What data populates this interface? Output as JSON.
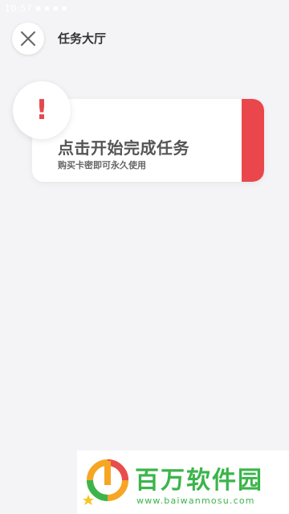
{
  "status_bar": {
    "time": "10:57",
    "icons": [
      "notification-icon",
      "wechat-icon",
      "signal-icon",
      "wifi-icon"
    ]
  },
  "header": {
    "title": "任务大厅",
    "close_icon": "close-icon"
  },
  "task_card": {
    "badge_icon": "alert-icon",
    "badge_symbol": "!",
    "title": "点击开始完成任务",
    "subtitle": "购买卡密即可永久使用",
    "accent_color": "#e9474b"
  },
  "watermark": {
    "name": "百万软件园",
    "url": "www.baiwanmosu.com",
    "color": "#3bb54a"
  }
}
